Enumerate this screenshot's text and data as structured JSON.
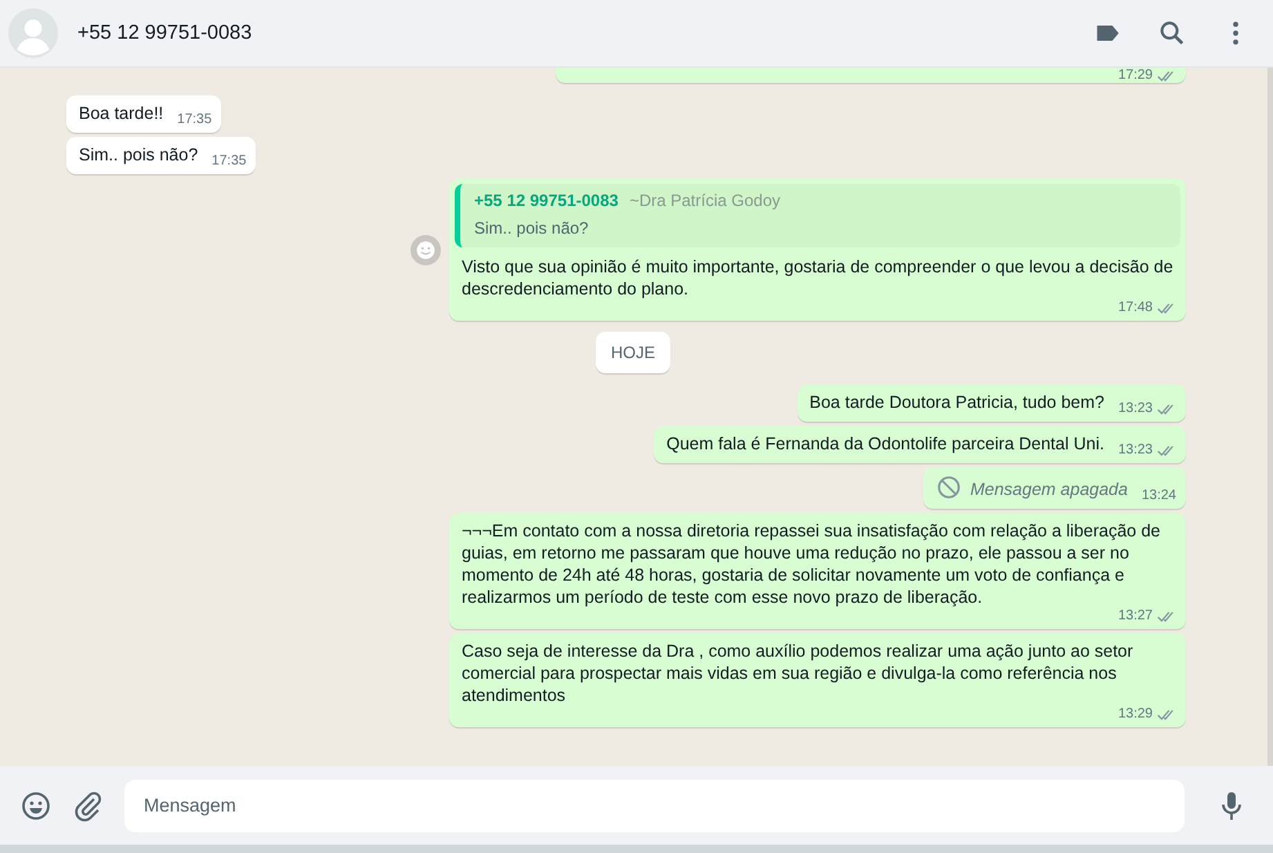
{
  "header": {
    "title": "+55 12 99751-0083"
  },
  "messages": [
    {
      "kind": "out",
      "time": "17:29",
      "partial": true
    },
    {
      "kind": "in",
      "text": "Boa tarde!!",
      "time": "17:35"
    },
    {
      "kind": "in",
      "text": "Sim.. pois não?",
      "time": "17:35"
    },
    {
      "kind": "out",
      "text": "Visto que sua opinião é muito importante, gostaria de compreender o que levou a decisão de descredenciamento do plano.",
      "time": "17:48",
      "reaction_button": true,
      "quote": {
        "author": "+55 12 99751-0083",
        "name": "~Dra Patrícia Godoy",
        "text": "Sim.. pois não?"
      }
    },
    {
      "kind": "date",
      "text": "HOJE"
    },
    {
      "kind": "out",
      "text": "Boa tarde Doutora Patricia, tudo bem?",
      "time": "13:23"
    },
    {
      "kind": "out",
      "text": "Quem fala é Fernanda da Odontolife parceira Dental Uni.",
      "time": "13:23"
    },
    {
      "kind": "deleted",
      "text": "Mensagem apagada",
      "time": "13:24"
    },
    {
      "kind": "out",
      "text": "¬¬¬Em contato com a nossa diretoria repassei sua insatisfação com relação a liberação de guias, em retorno me passaram que houve uma redução no prazo, ele passou a ser no momento de 24h até 48 horas, gostaria de solicitar novamente um voto de confiança e realizarmos um período de teste com esse novo prazo de liberação.",
      "time": "13:27"
    },
    {
      "kind": "out",
      "text": "Caso seja de interesse da Dra , como auxílio podemos realizar uma ação junto ao setor comercial para prospectar mais vidas em sua região e divulga-la como referência nos atendimentos",
      "time": "13:29"
    }
  ],
  "composer": {
    "placeholder": "Mensagem"
  }
}
